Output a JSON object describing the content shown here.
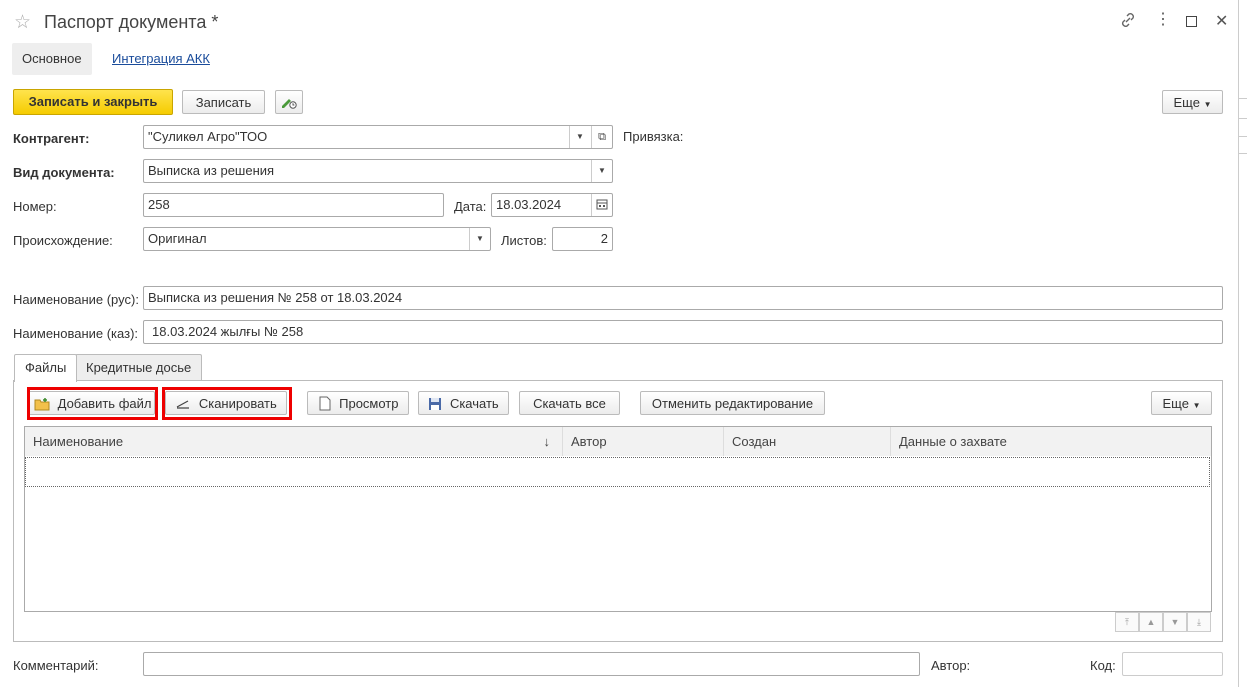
{
  "window": {
    "title": "Паспорт документа *"
  },
  "nav": {
    "main_tab": "Основное",
    "integration_link": "Интеграция АКК"
  },
  "toolbar": {
    "save_close": "Записать и закрыть",
    "save": "Записать",
    "more": "Еще"
  },
  "form": {
    "contractor_label": "Контрагент:",
    "contractor_value": "\"Суликөл Агро\"ТОО",
    "binding_label": "Привязка:",
    "doctype_label": "Вид документа:",
    "doctype_value": "Выписка из решения",
    "number_label": "Номер:",
    "number_value": "258",
    "date_label": "Дата:",
    "date_value": "18.03.2024",
    "origin_label": "Происхождение:",
    "origin_value": "Оригинал",
    "sheets_label": "Листов:",
    "sheets_value": "2",
    "name_rus_label": "Наименование (рус):",
    "name_rus_value": "Выписка из решения № 258 от 18.03.2024",
    "name_kaz_label": "Наименование (каз):",
    "name_kaz_value": "18.03.2024 жылғы № 258"
  },
  "tabs": {
    "files": "Файлы",
    "credit": "Кредитные досье"
  },
  "files_toolbar": {
    "add_file": "Добавить файл",
    "scan": "Сканировать",
    "view": "Просмотр",
    "download": "Скачать",
    "download_all": "Скачать все",
    "cancel_edit": "Отменить редактирование",
    "more": "Еще"
  },
  "table": {
    "columns": [
      "Наименование",
      "Автор",
      "Создан",
      "Данные о захвате"
    ],
    "sort_indicator": "↓"
  },
  "footer": {
    "comment_label": "Комментарий:",
    "author_label": "Автор:",
    "code_label": "Код:"
  },
  "colors": {
    "primary_button": "#f5cc00",
    "highlight": "#ee0000",
    "link": "#1a4c9b"
  }
}
